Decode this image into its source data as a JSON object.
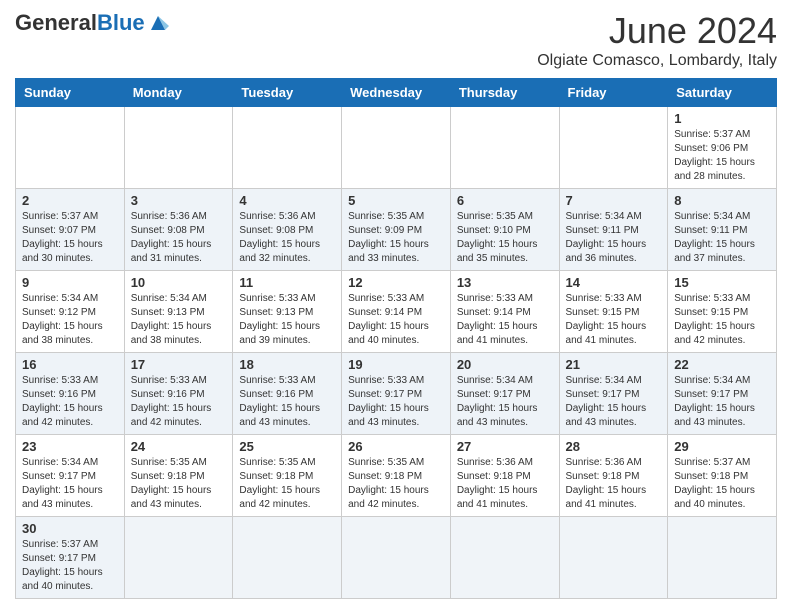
{
  "header": {
    "logo_general": "General",
    "logo_blue": "Blue",
    "month_year": "June 2024",
    "location": "Olgiate Comasco, Lombardy, Italy"
  },
  "weekdays": [
    "Sunday",
    "Monday",
    "Tuesday",
    "Wednesday",
    "Thursday",
    "Friday",
    "Saturday"
  ],
  "weeks": [
    [
      {
        "day": "",
        "info": ""
      },
      {
        "day": "",
        "info": ""
      },
      {
        "day": "",
        "info": ""
      },
      {
        "day": "",
        "info": ""
      },
      {
        "day": "",
        "info": ""
      },
      {
        "day": "",
        "info": ""
      },
      {
        "day": "1",
        "info": "Sunrise: 5:37 AM\nSunset: 9:06 PM\nDaylight: 15 hours and 28 minutes."
      }
    ],
    [
      {
        "day": "2",
        "info": "Sunrise: 5:37 AM\nSunset: 9:07 PM\nDaylight: 15 hours and 30 minutes."
      },
      {
        "day": "3",
        "info": "Sunrise: 5:36 AM\nSunset: 9:08 PM\nDaylight: 15 hours and 31 minutes."
      },
      {
        "day": "4",
        "info": "Sunrise: 5:36 AM\nSunset: 9:08 PM\nDaylight: 15 hours and 32 minutes."
      },
      {
        "day": "5",
        "info": "Sunrise: 5:35 AM\nSunset: 9:09 PM\nDaylight: 15 hours and 33 minutes."
      },
      {
        "day": "6",
        "info": "Sunrise: 5:35 AM\nSunset: 9:10 PM\nDaylight: 15 hours and 35 minutes."
      },
      {
        "day": "7",
        "info": "Sunrise: 5:34 AM\nSunset: 9:11 PM\nDaylight: 15 hours and 36 minutes."
      },
      {
        "day": "8",
        "info": "Sunrise: 5:34 AM\nSunset: 9:11 PM\nDaylight: 15 hours and 37 minutes."
      }
    ],
    [
      {
        "day": "9",
        "info": "Sunrise: 5:34 AM\nSunset: 9:12 PM\nDaylight: 15 hours and 38 minutes."
      },
      {
        "day": "10",
        "info": "Sunrise: 5:34 AM\nSunset: 9:13 PM\nDaylight: 15 hours and 38 minutes."
      },
      {
        "day": "11",
        "info": "Sunrise: 5:33 AM\nSunset: 9:13 PM\nDaylight: 15 hours and 39 minutes."
      },
      {
        "day": "12",
        "info": "Sunrise: 5:33 AM\nSunset: 9:14 PM\nDaylight: 15 hours and 40 minutes."
      },
      {
        "day": "13",
        "info": "Sunrise: 5:33 AM\nSunset: 9:14 PM\nDaylight: 15 hours and 41 minutes."
      },
      {
        "day": "14",
        "info": "Sunrise: 5:33 AM\nSunset: 9:15 PM\nDaylight: 15 hours and 41 minutes."
      },
      {
        "day": "15",
        "info": "Sunrise: 5:33 AM\nSunset: 9:15 PM\nDaylight: 15 hours and 42 minutes."
      }
    ],
    [
      {
        "day": "16",
        "info": "Sunrise: 5:33 AM\nSunset: 9:16 PM\nDaylight: 15 hours and 42 minutes."
      },
      {
        "day": "17",
        "info": "Sunrise: 5:33 AM\nSunset: 9:16 PM\nDaylight: 15 hours and 42 minutes."
      },
      {
        "day": "18",
        "info": "Sunrise: 5:33 AM\nSunset: 9:16 PM\nDaylight: 15 hours and 43 minutes."
      },
      {
        "day": "19",
        "info": "Sunrise: 5:33 AM\nSunset: 9:17 PM\nDaylight: 15 hours and 43 minutes."
      },
      {
        "day": "20",
        "info": "Sunrise: 5:34 AM\nSunset: 9:17 PM\nDaylight: 15 hours and 43 minutes."
      },
      {
        "day": "21",
        "info": "Sunrise: 5:34 AM\nSunset: 9:17 PM\nDaylight: 15 hours and 43 minutes."
      },
      {
        "day": "22",
        "info": "Sunrise: 5:34 AM\nSunset: 9:17 PM\nDaylight: 15 hours and 43 minutes."
      }
    ],
    [
      {
        "day": "23",
        "info": "Sunrise: 5:34 AM\nSunset: 9:17 PM\nDaylight: 15 hours and 43 minutes."
      },
      {
        "day": "24",
        "info": "Sunrise: 5:35 AM\nSunset: 9:18 PM\nDaylight: 15 hours and 43 minutes."
      },
      {
        "day": "25",
        "info": "Sunrise: 5:35 AM\nSunset: 9:18 PM\nDaylight: 15 hours and 42 minutes."
      },
      {
        "day": "26",
        "info": "Sunrise: 5:35 AM\nSunset: 9:18 PM\nDaylight: 15 hours and 42 minutes."
      },
      {
        "day": "27",
        "info": "Sunrise: 5:36 AM\nSunset: 9:18 PM\nDaylight: 15 hours and 41 minutes."
      },
      {
        "day": "28",
        "info": "Sunrise: 5:36 AM\nSunset: 9:18 PM\nDaylight: 15 hours and 41 minutes."
      },
      {
        "day": "29",
        "info": "Sunrise: 5:37 AM\nSunset: 9:18 PM\nDaylight: 15 hours and 40 minutes."
      }
    ],
    [
      {
        "day": "30",
        "info": "Sunrise: 5:37 AM\nSunset: 9:17 PM\nDaylight: 15 hours and 40 minutes."
      },
      {
        "day": "",
        "info": ""
      },
      {
        "day": "",
        "info": ""
      },
      {
        "day": "",
        "info": ""
      },
      {
        "day": "",
        "info": ""
      },
      {
        "day": "",
        "info": ""
      },
      {
        "day": "",
        "info": ""
      }
    ]
  ]
}
